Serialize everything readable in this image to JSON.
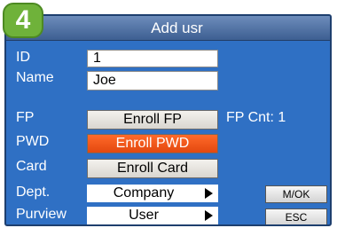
{
  "step_badge": "4",
  "window": {
    "title": "Add usr"
  },
  "form": {
    "id": {
      "label": "ID",
      "value": "1"
    },
    "name": {
      "label": "Name",
      "value": "Joe"
    },
    "fp": {
      "label": "FP",
      "button": "Enroll FP",
      "count_label": "FP Cnt: 1"
    },
    "pwd": {
      "label": "PWD",
      "button": "Enroll PWD"
    },
    "card": {
      "label": "Card",
      "button": "Enroll Card"
    },
    "dept": {
      "label": "Dept.",
      "value": "Company"
    },
    "purview": {
      "label": "Purview",
      "value": "User"
    }
  },
  "actions": {
    "ok": "M/OK",
    "esc": "ESC"
  },
  "colors": {
    "screen_bg": "#2f70c4",
    "highlight": "#e3480f",
    "badge": "#6fb23a"
  }
}
